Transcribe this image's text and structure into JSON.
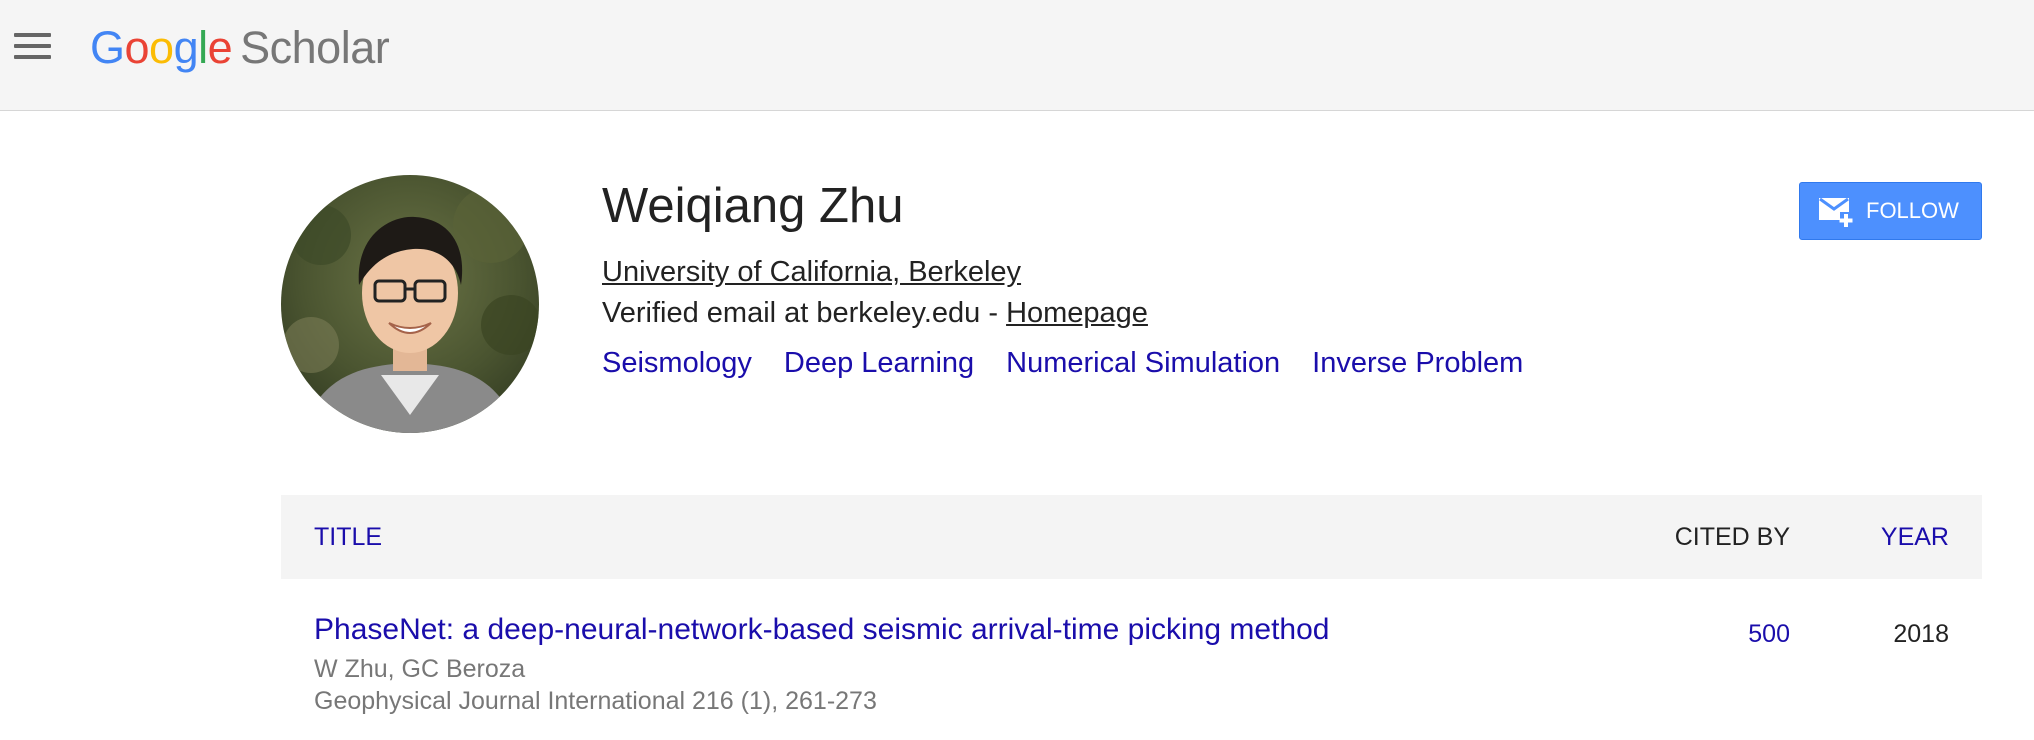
{
  "header": {
    "logo_google": [
      "G",
      "o",
      "o",
      "g",
      "l",
      "e"
    ],
    "logo_scholar": "Scholar",
    "menu_icon": "hamburger-menu-icon"
  },
  "profile": {
    "name": "Weiqiang Zhu",
    "affiliation": "University of California, Berkeley",
    "email_text": "Verified email at berkeley.edu - ",
    "homepage_label": "Homepage",
    "interests": [
      "Seismology",
      "Deep Learning",
      "Numerical Simulation",
      "Inverse Problem"
    ],
    "follow_label": "FOLLOW",
    "follow_icon": "email-plus-icon"
  },
  "table": {
    "headers": {
      "title": "TITLE",
      "cited_by": "CITED BY",
      "year": "YEAR"
    },
    "rows": [
      {
        "title": "PhaseNet: a deep-neural-network-based seismic arrival-time picking method",
        "authors": "W Zhu, GC Beroza",
        "venue": "Geophysical Journal International 216 (1), 261-273",
        "cited_by": "500",
        "year": "2018"
      }
    ]
  },
  "colors": {
    "link": "#1a0dab",
    "follow_button": "#4d90fe",
    "topbar": "#f5f5f5",
    "google_blue": "#4285f4",
    "google_red": "#ea4335",
    "google_yellow": "#fbbc05",
    "google_green": "#34a853"
  }
}
